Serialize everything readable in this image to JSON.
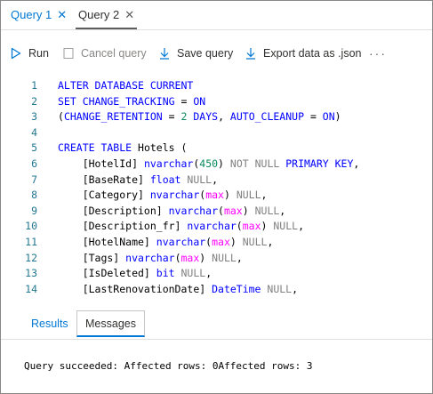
{
  "tabs": [
    {
      "label": "Query 1",
      "close": "✕"
    },
    {
      "label": "Query 2",
      "close": "✕"
    }
  ],
  "toolbar": {
    "run": "Run",
    "cancel": "Cancel query",
    "save": "Save query",
    "export": "Export data as .json",
    "more": "···"
  },
  "editor": {
    "lines": [
      {
        "n": "1",
        "parts": [
          [
            "kw",
            "ALTER DATABASE CURRENT"
          ]
        ]
      },
      {
        "n": "2",
        "parts": [
          [
            "kw",
            "SET CHANGE_TRACKING "
          ],
          [
            "op",
            "= "
          ],
          [
            "kw",
            "ON"
          ]
        ]
      },
      {
        "n": "3",
        "parts": [
          [
            "op",
            "("
          ],
          [
            "kw",
            "CHANGE_RETENTION "
          ],
          [
            "op",
            "= "
          ],
          [
            "num",
            "2"
          ],
          [
            "kw",
            " DAYS"
          ],
          [
            "op",
            ", "
          ],
          [
            "kw",
            "AUTO_CLEANUP "
          ],
          [
            "op",
            "= "
          ],
          [
            "kw",
            "ON"
          ],
          [
            "op",
            ")"
          ]
        ]
      },
      {
        "n": "4",
        "parts": []
      },
      {
        "n": "5",
        "parts": [
          [
            "kw",
            "CREATE TABLE "
          ],
          [
            "id",
            "Hotels ("
          ]
        ]
      },
      {
        "n": "6",
        "parts": [
          [
            "id",
            "    [HotelId] "
          ],
          [
            "kw",
            "nvarchar"
          ],
          [
            "op",
            "("
          ],
          [
            "num",
            "450"
          ],
          [
            "op",
            ") "
          ],
          [
            "gray",
            "NOT NULL "
          ],
          [
            "kw",
            "PRIMARY KEY"
          ],
          [
            "op",
            ","
          ]
        ]
      },
      {
        "n": "7",
        "parts": [
          [
            "id",
            "    [BaseRate] "
          ],
          [
            "kw",
            "float "
          ],
          [
            "gray",
            "NULL"
          ],
          [
            "op",
            ","
          ]
        ]
      },
      {
        "n": "8",
        "parts": [
          [
            "id",
            "    [Category] "
          ],
          [
            "kw",
            "nvarchar"
          ],
          [
            "op",
            "("
          ],
          [
            "fn",
            "max"
          ],
          [
            "op",
            ") "
          ],
          [
            "gray",
            "NULL"
          ],
          [
            "op",
            ","
          ]
        ]
      },
      {
        "n": "9",
        "parts": [
          [
            "id",
            "    [Description] "
          ],
          [
            "kw",
            "nvarchar"
          ],
          [
            "op",
            "("
          ],
          [
            "fn",
            "max"
          ],
          [
            "op",
            ") "
          ],
          [
            "gray",
            "NULL"
          ],
          [
            "op",
            ","
          ]
        ]
      },
      {
        "n": "10",
        "parts": [
          [
            "id",
            "    [Description_fr] "
          ],
          [
            "kw",
            "nvarchar"
          ],
          [
            "op",
            "("
          ],
          [
            "fn",
            "max"
          ],
          [
            "op",
            ") "
          ],
          [
            "gray",
            "NULL"
          ],
          [
            "op",
            ","
          ]
        ]
      },
      {
        "n": "11",
        "parts": [
          [
            "id",
            "    [HotelName] "
          ],
          [
            "kw",
            "nvarchar"
          ],
          [
            "op",
            "("
          ],
          [
            "fn",
            "max"
          ],
          [
            "op",
            ") "
          ],
          [
            "gray",
            "NULL"
          ],
          [
            "op",
            ","
          ]
        ]
      },
      {
        "n": "12",
        "parts": [
          [
            "id",
            "    [Tags] "
          ],
          [
            "kw",
            "nvarchar"
          ],
          [
            "op",
            "("
          ],
          [
            "fn",
            "max"
          ],
          [
            "op",
            ") "
          ],
          [
            "gray",
            "NULL"
          ],
          [
            "op",
            ","
          ]
        ]
      },
      {
        "n": "13",
        "parts": [
          [
            "id",
            "    [IsDeleted] "
          ],
          [
            "kw",
            "bit "
          ],
          [
            "gray",
            "NULL"
          ],
          [
            "op",
            ","
          ]
        ]
      },
      {
        "n": "14",
        "parts": [
          [
            "id",
            "    [LastRenovationDate] "
          ],
          [
            "kw",
            "DateTime "
          ],
          [
            "gray",
            "NULL"
          ],
          [
            "op",
            ","
          ]
        ]
      }
    ]
  },
  "results_tabs": {
    "results": "Results",
    "messages": "Messages"
  },
  "message_text": "Query succeeded: Affected rows: 0Affected rows: 3",
  "colors": {
    "accent": "#0078d4",
    "keyword": "#0000ff",
    "function": "#ff00ff",
    "number": "#09885a",
    "null": "#808080",
    "line_number": "#237893"
  },
  "icons": {
    "run": "play-icon",
    "cancel": "cancel-icon",
    "save": "download-arrow-icon",
    "export": "download-arrow-icon",
    "more": "more-icon"
  }
}
